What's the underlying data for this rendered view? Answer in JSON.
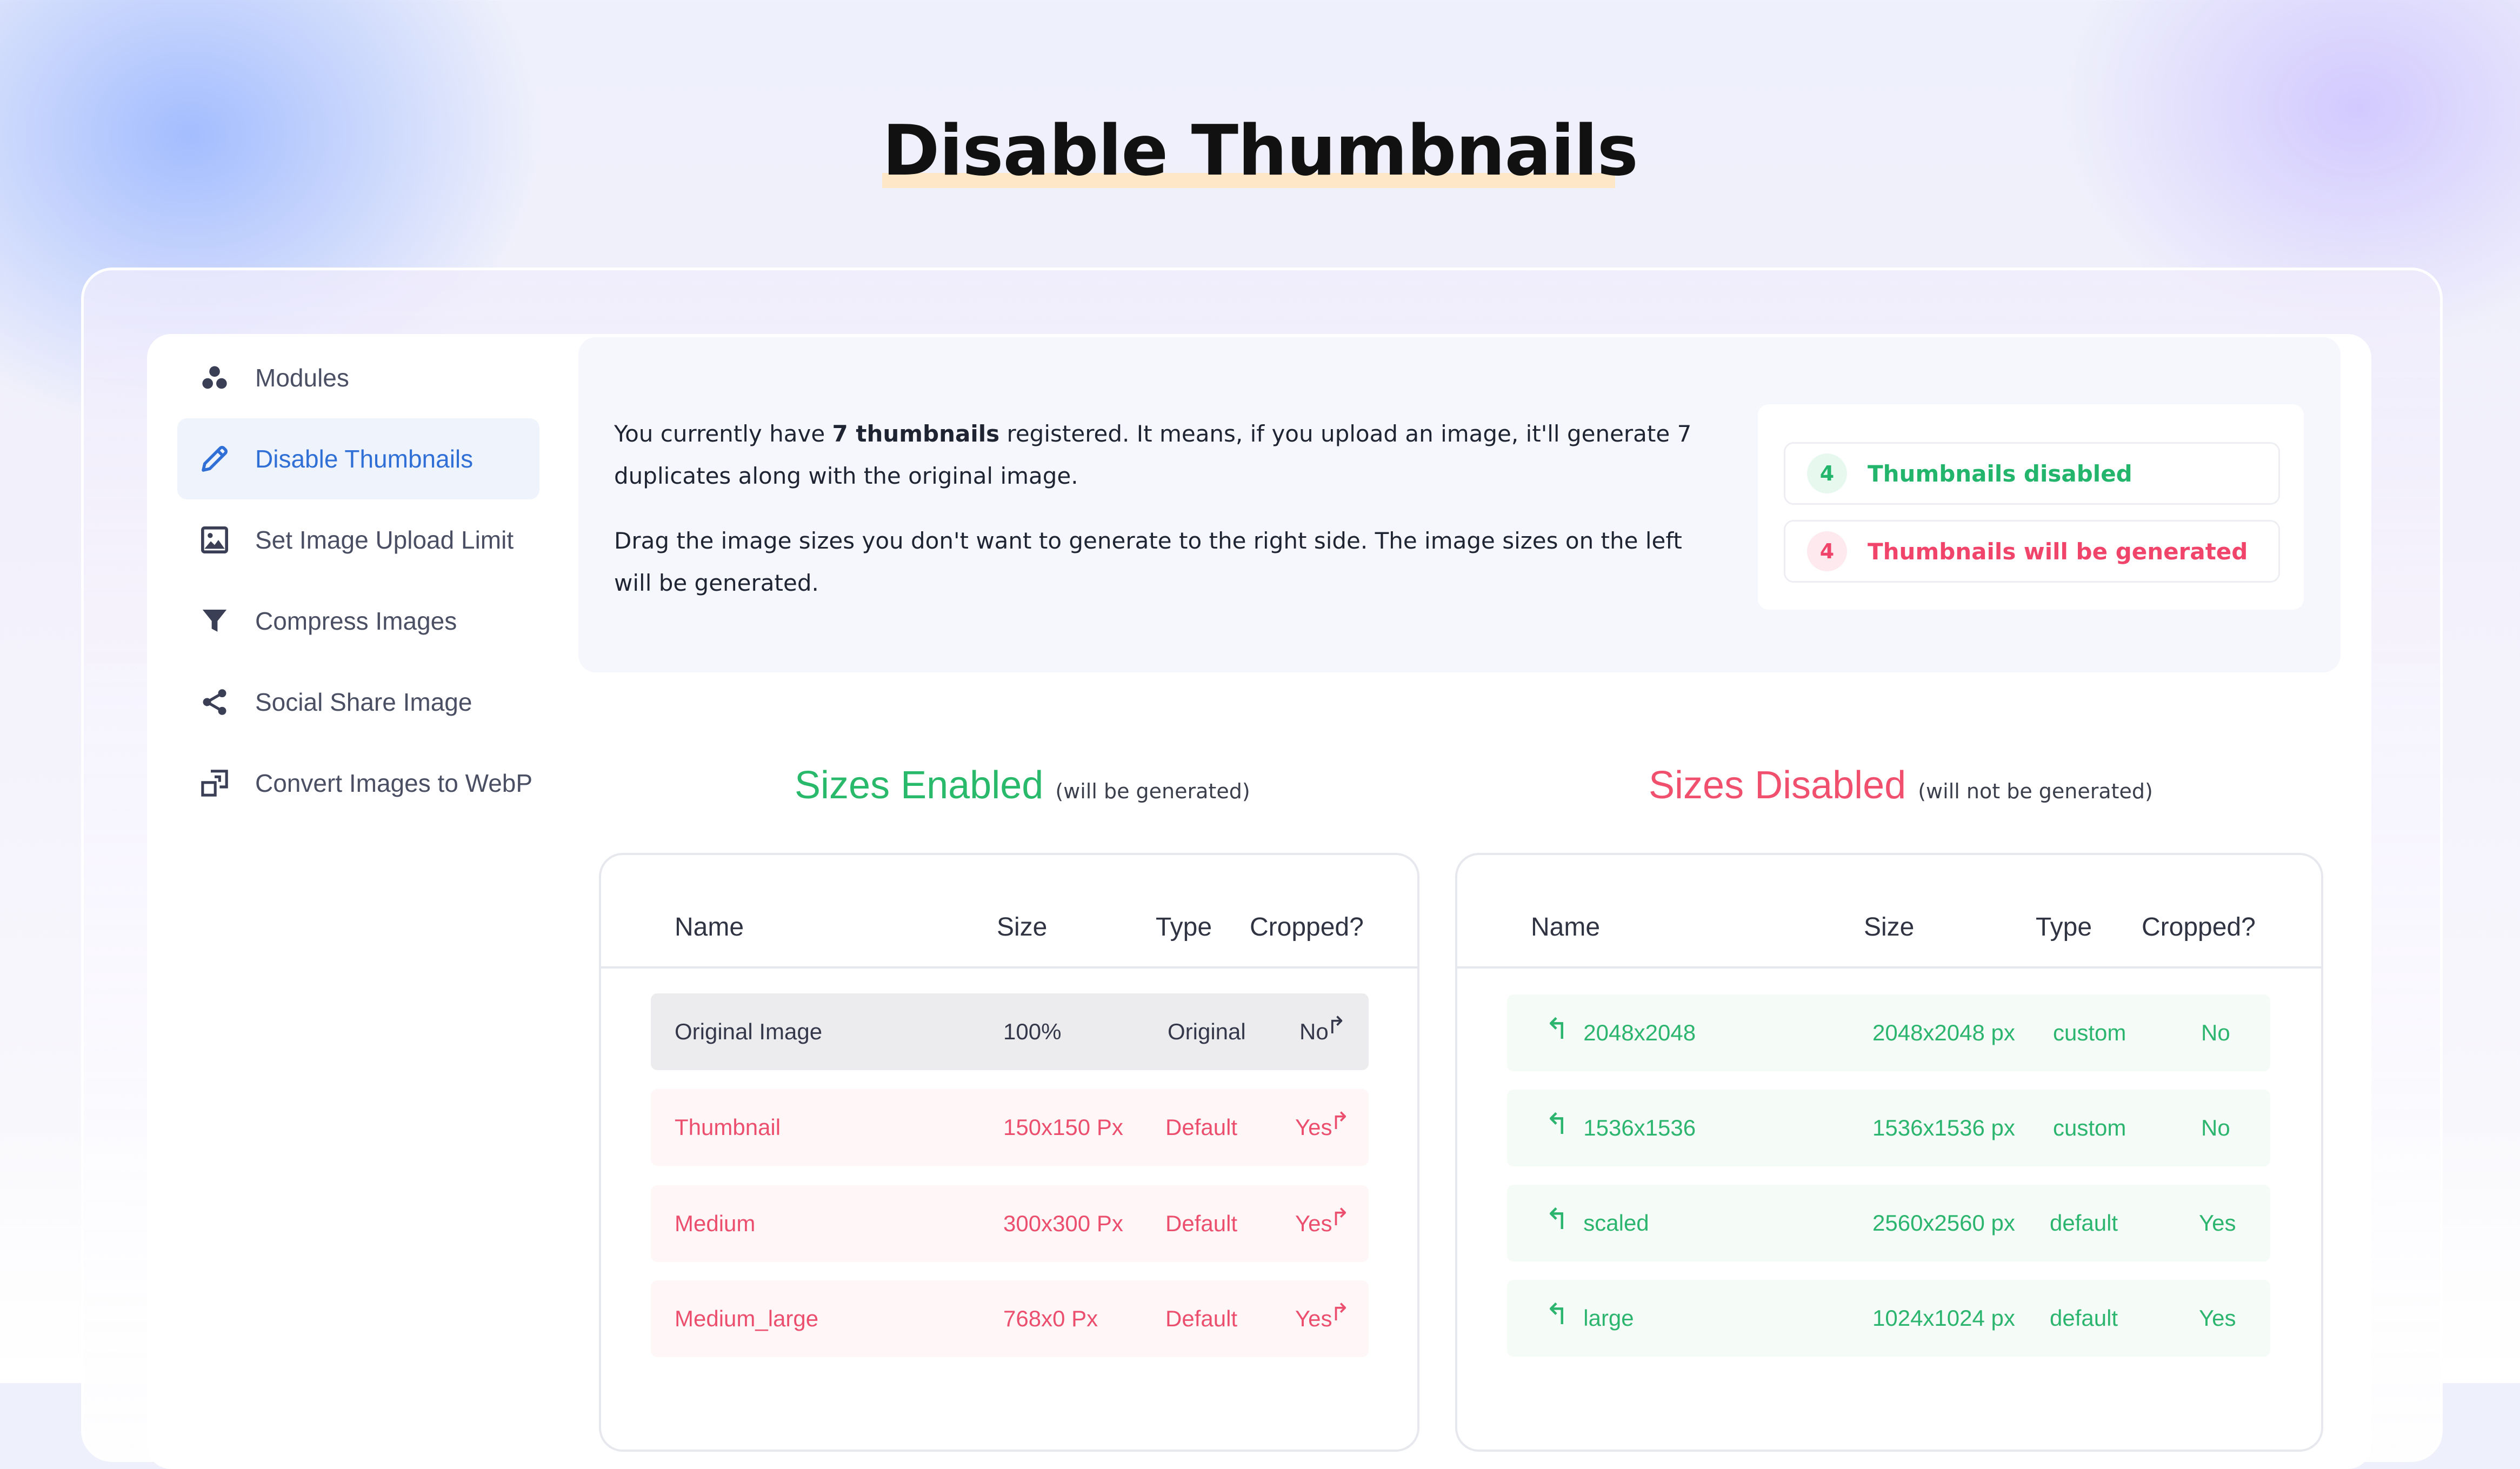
{
  "page_title": "Disable Thumbnails",
  "sidebar": {
    "items": [
      {
        "label": "Modules",
        "icon": "modules-icon",
        "active": false
      },
      {
        "label": "Disable Thumbnails",
        "icon": "pencil-icon",
        "active": true
      },
      {
        "label": "Set Image Upload Limit",
        "icon": "image-icon",
        "active": false
      },
      {
        "label": "Compress Images",
        "icon": "funnel-icon",
        "active": false
      },
      {
        "label": "Social Share Image",
        "icon": "share-icon",
        "active": false
      },
      {
        "label": "Convert Images to WebP",
        "icon": "convert-icon",
        "active": false
      }
    ]
  },
  "info": {
    "para1_prefix": "You currently have ",
    "para1_bold": "7 thumbnails",
    "para1_suffix": " registered. It means, if you upload an image, it'll generate 7 duplicates along with the original image.",
    "para2": "Drag the image sizes you don't want to generate to the right side. The image sizes on the left will be generated."
  },
  "stats": {
    "disabled_count": "4",
    "disabled_label": "Thumbnails disabled",
    "generated_count": "4",
    "generated_label": "Thumbnails will be generated"
  },
  "enabled_section": {
    "title": "Sizes Enabled",
    "note": "(will be generated)",
    "headers": [
      "Name",
      "Size",
      "Type",
      "Cropped?"
    ],
    "rows": [
      {
        "name": "Original Image",
        "size": "100%",
        "type": "Original",
        "cropped": "No",
        "style": "grey"
      },
      {
        "name": "Thumbnail",
        "size": "150x150 Px",
        "type": "Default",
        "cropped": "Yes",
        "style": "pink"
      },
      {
        "name": "Medium",
        "size": "300x300 Px",
        "type": "Default",
        "cropped": "Yes",
        "style": "pink"
      },
      {
        "name": "Medium_large",
        "size": "768x0 Px",
        "type": "Default",
        "cropped": "Yes",
        "style": "pink"
      }
    ]
  },
  "disabled_section": {
    "title": "Sizes Disabled",
    "note": "(will not be generated)",
    "headers": [
      "Name",
      "Size",
      "Type",
      "Cropped?"
    ],
    "rows": [
      {
        "name": "2048x2048",
        "size": "2048x2048 px",
        "type": "custom",
        "cropped": "No"
      },
      {
        "name": "1536x1536",
        "size": "1536x1536 px",
        "type": "custom",
        "cropped": "No"
      },
      {
        "name": "scaled",
        "size": "2560x2560 px",
        "type": "default",
        "cropped": "Yes"
      },
      {
        "name": "large",
        "size": "1024x1024 px",
        "type": "default",
        "cropped": "Yes"
      }
    ]
  },
  "colors": {
    "accent_blue": "#2f6fd6",
    "enabled_green": "#28b96b",
    "disabled_red": "#f0506e"
  }
}
